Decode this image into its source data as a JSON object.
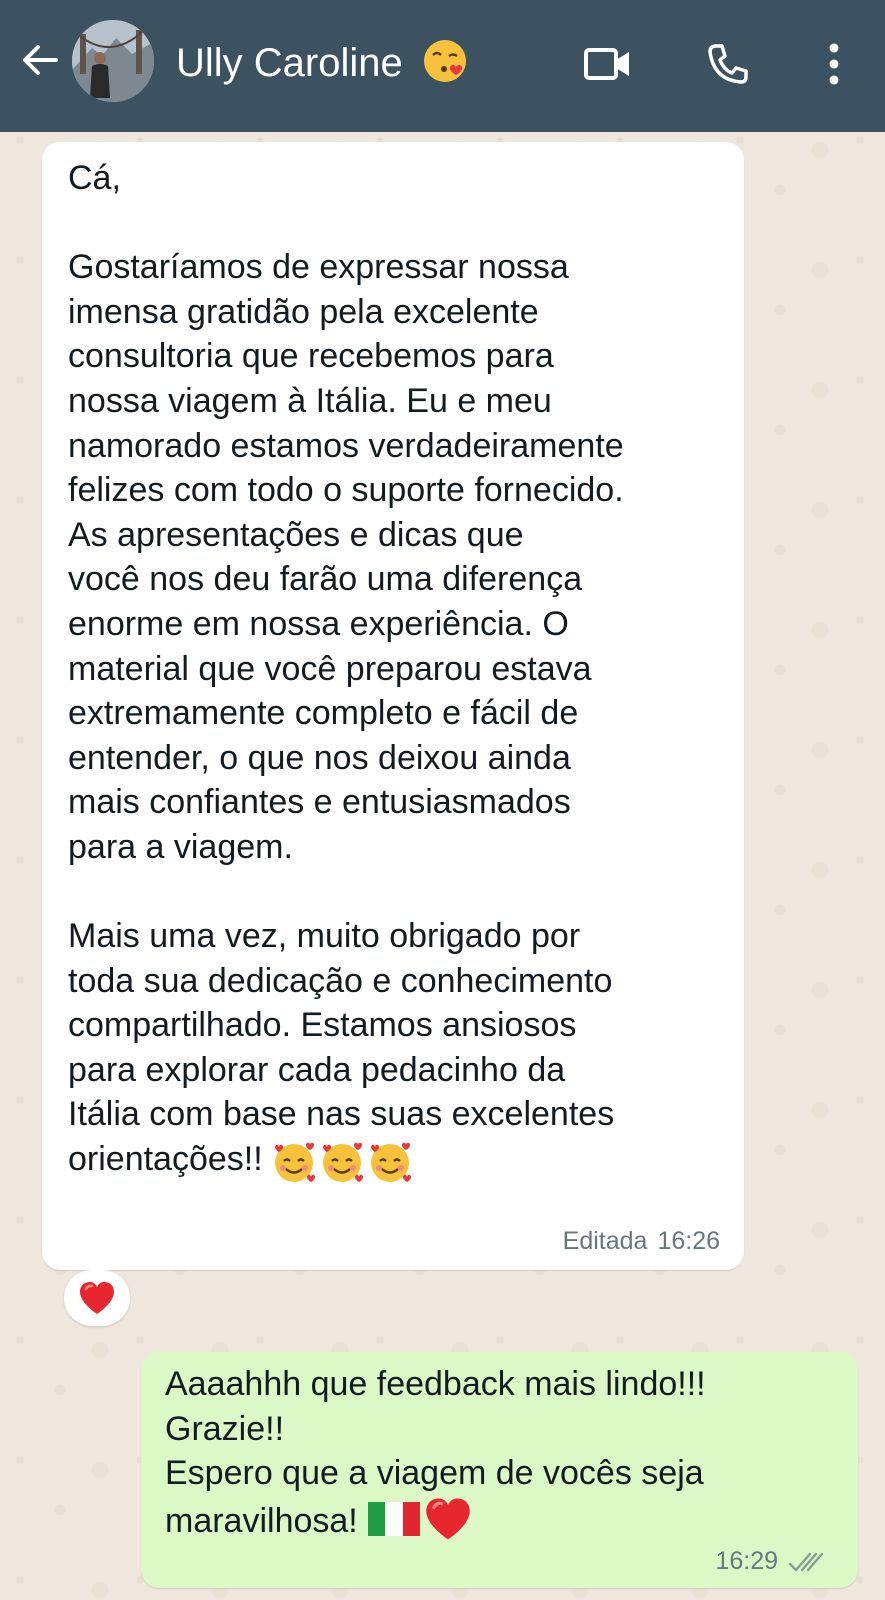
{
  "header": {
    "contact_name": "Ully Caroline",
    "name_emoji": "face-blowing-a-kiss",
    "back_icon": "arrow-left-icon",
    "video_icon": "video-camera-icon",
    "call_icon": "phone-icon",
    "menu_icon": "more-vertical-icon",
    "background_color": "#3c5260"
  },
  "messages": [
    {
      "direction": "incoming",
      "paragraphs": [
        "Cá,",
        "",
        "Gostaríamos de expressar nossa\nimensa gratidão pela excelente\nconsultoria que recebemos para\nnossa viagem à Itália. Eu e meu\nnamorado estamos verdadeiramente\nfelizes com todo o suporte fornecido.\nAs apresentações e dicas que\nvocê nos deu farão uma diferença\nenorme em nossa experiência. O\nmaterial que você preparou estava\nextremamente completo e fácil de\nentender, o que nos deixou ainda\nmais confiantes e entusiasmados\npara a viagem.",
        "",
        "Mais uma vez, muito obrigado por\ntoda sua dedicação e conhecimento\ncompartilhado. Estamos ansiosos\npara explorar cada pedacinho da\nItália com base nas suas excelentes\norientações!!"
      ],
      "trailing_emojis": [
        "smiling-face-with-hearts",
        "smiling-face-with-hearts",
        "smiling-face-with-hearts"
      ],
      "edited_label": "Editada",
      "time": "16:26",
      "reaction": "red-heart",
      "bubble_color": "#ffffff"
    },
    {
      "direction": "outgoing",
      "text": "Aaaahhh que feedback mais lindo!!!\nGrazie!!\nEspero que a viagem de vocês seja\nmaravilhosa!",
      "trailing_emojis": [
        "flag-italy",
        "red-heart"
      ],
      "time": "16:29",
      "status": "read",
      "status_icon": "double-check-icon",
      "bubble_color": "#dcf8c6"
    }
  ]
}
